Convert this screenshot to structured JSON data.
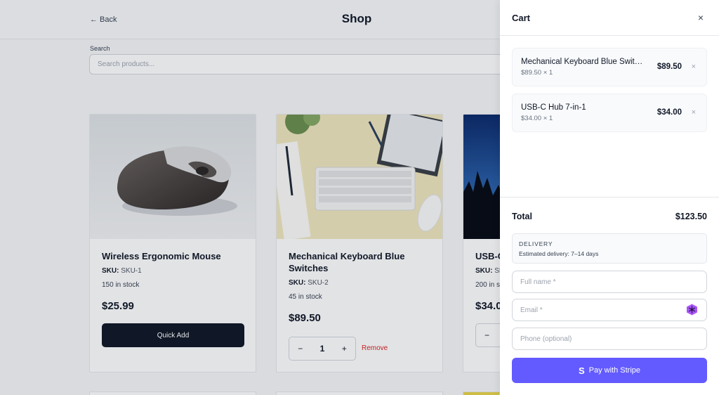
{
  "header": {
    "back_label": "← Back",
    "title": "Shop"
  },
  "search": {
    "label": "Search",
    "placeholder": "Search products..."
  },
  "products": [
    {
      "name": "Wireless Ergonomic Mouse",
      "sku_label": "SKU:",
      "sku": "SKU-1",
      "stock": "150 in stock",
      "price": "$25.99",
      "action": "Quick Add"
    },
    {
      "name": "Mechanical Keyboard Blue Switches",
      "sku_label": "SKU:",
      "sku": "SKU-2",
      "stock": "45 in stock",
      "price": "$89.50",
      "qty": "1",
      "minus": "−",
      "plus": "+",
      "remove": "Remove"
    },
    {
      "name": "USB-C",
      "sku_label": "SKU:",
      "sku": "SK",
      "stock": "200 in s",
      "price": "$34.0",
      "minus": "−"
    }
  ],
  "cart": {
    "title": "Cart",
    "close_label": "×",
    "items": [
      {
        "name": "Mechanical Keyboard Blue Switches",
        "sub": "$89.50 × 1",
        "price": "$89.50",
        "remove": "×"
      },
      {
        "name": "USB-C Hub 7-in-1",
        "sub": "$34.00 × 1",
        "price": "$34.00",
        "remove": "×"
      }
    ],
    "total_label": "Total",
    "total_value": "$123.50",
    "delivery": {
      "title": "DELIVERY",
      "text": "Estimated delivery: 7–14 days"
    },
    "fields": {
      "full_name": {
        "placeholder": "Full name *",
        "value": ""
      },
      "email": {
        "placeholder": "Email *",
        "value": ""
      },
      "phone": {
        "placeholder": "Phone (optional)",
        "value": ""
      }
    },
    "pay_icon": "S",
    "pay_label": "Pay with Stripe"
  },
  "colors": {
    "primary_dark": "#111827",
    "stripe": "#635bff",
    "danger": "#dc2626",
    "email_icon": "#a855f7"
  }
}
